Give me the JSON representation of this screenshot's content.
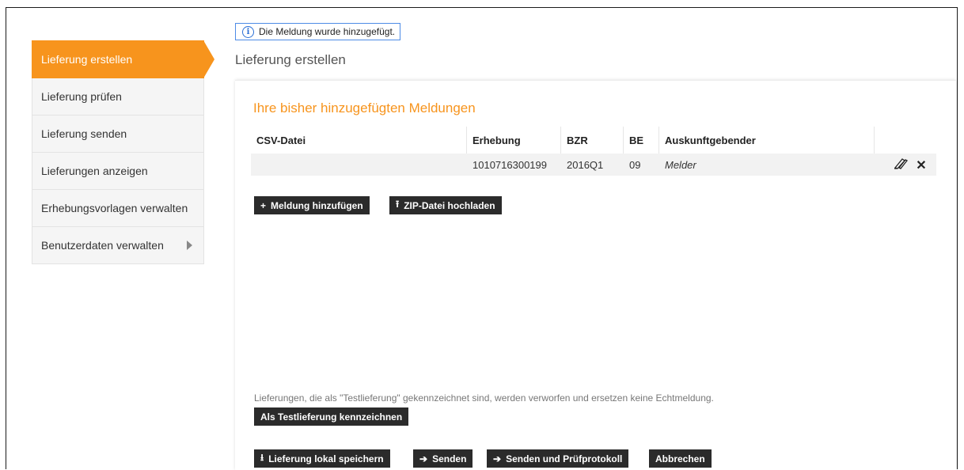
{
  "sidebar": {
    "items": [
      {
        "label": "Lieferung erstellen"
      },
      {
        "label": "Lieferung prüfen"
      },
      {
        "label": "Lieferung senden"
      },
      {
        "label": "Lieferungen anzeigen"
      },
      {
        "label": "Erhebungsvorlagen verwalten"
      },
      {
        "label": "Benutzerdaten verwalten"
      }
    ]
  },
  "info_message": "Die Meldung wurde hinzugefügt.",
  "page_title": "Lieferung erstellen",
  "section_title": "Ihre bisher hinzugefügten Meldungen",
  "table": {
    "columns": [
      "CSV-Datei",
      "Erhebung",
      "BZR",
      "BE",
      "Auskunftgebender"
    ],
    "rows": [
      {
        "csv": "",
        "erhebung": "1010716300199",
        "bzr": "2016Q1",
        "be": "09",
        "auskunftgebender": "Melder"
      }
    ]
  },
  "buttons": {
    "add_report": "Meldung hinzufügen",
    "upload_zip": "ZIP-Datei hochladen",
    "mark_test": "Als Testlieferung kennzeichnen",
    "save_local": "Lieferung lokal speichern",
    "send": "Senden",
    "send_protocol": "Senden und Prüfprotokoll",
    "cancel": "Abbrechen"
  },
  "test_note": "Lieferungen, die als \"Testlieferung\" gekennzeichnet sind, werden verworfen und ersetzen keine Echtmeldung.",
  "colors": {
    "accent": "#f7941d",
    "button": "#2b2b2b",
    "info_border": "#4d8be6"
  }
}
